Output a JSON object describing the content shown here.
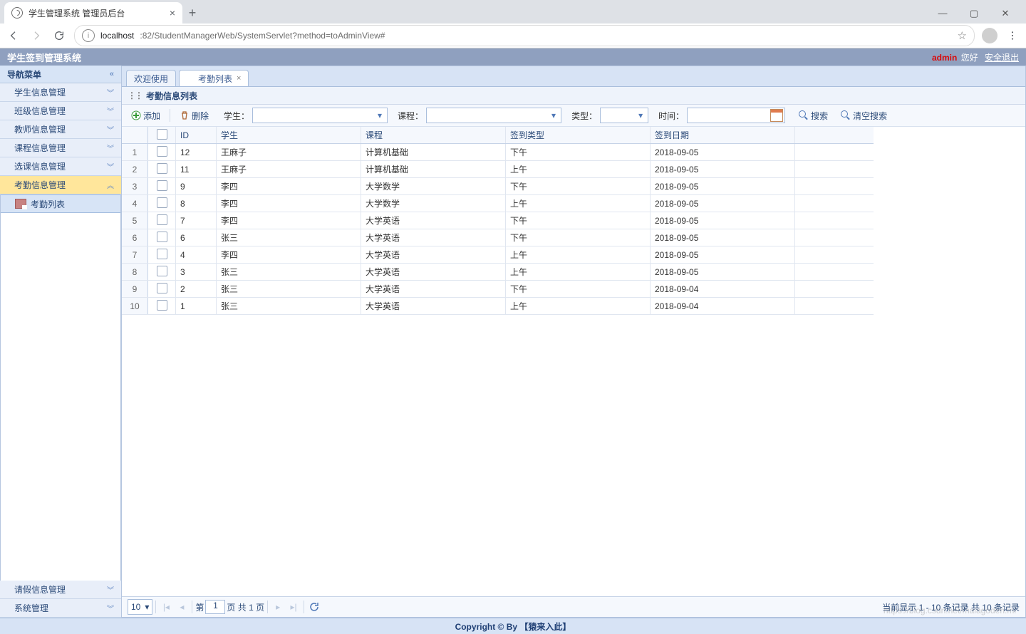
{
  "browser": {
    "tab_title": "学生管理系统 管理员后台",
    "url_host": "localhost",
    "url_path": ":82/StudentManagerWeb/SystemServlet?method=toAdminView#"
  },
  "appbar": {
    "title": "学生签到管理系统",
    "user": "admin",
    "hello": "您好",
    "logout": "安全退出"
  },
  "nav": {
    "header": "导航菜单",
    "items": [
      {
        "label": "学生信息管理",
        "selected": false
      },
      {
        "label": "班级信息管理",
        "selected": false
      },
      {
        "label": "教师信息管理",
        "selected": false
      },
      {
        "label": "课程信息管理",
        "selected": false
      },
      {
        "label": "选课信息管理",
        "selected": false
      },
      {
        "label": "考勤信息管理",
        "selected": true
      }
    ],
    "sub_item": "考勤列表",
    "bottom": [
      {
        "label": "请假信息管理"
      },
      {
        "label": "系统管理"
      }
    ]
  },
  "tabs": {
    "welcome": "欢迎使用",
    "attendance": "考勤列表"
  },
  "panel": {
    "title": "考勤信息列表"
  },
  "toolbar": {
    "add": "添加",
    "delete": "删除",
    "student_label": "学生：",
    "course_label": "课程：",
    "type_label": "类型：",
    "time_label": "时间：",
    "search": "搜索",
    "clear": "清空搜索"
  },
  "table": {
    "headers": {
      "id": "ID",
      "student": "学生",
      "course": "课程",
      "type": "签到类型",
      "date": "签到日期"
    },
    "rows": [
      {
        "n": "1",
        "id": "12",
        "student": "王麻子",
        "course": "计算机基础",
        "type": "下午",
        "date": "2018-09-05"
      },
      {
        "n": "2",
        "id": "11",
        "student": "王麻子",
        "course": "计算机基础",
        "type": "上午",
        "date": "2018-09-05"
      },
      {
        "n": "3",
        "id": "9",
        "student": "李四",
        "course": "大学数学",
        "type": "下午",
        "date": "2018-09-05"
      },
      {
        "n": "4",
        "id": "8",
        "student": "李四",
        "course": "大学数学",
        "type": "上午",
        "date": "2018-09-05"
      },
      {
        "n": "5",
        "id": "7",
        "student": "李四",
        "course": "大学英语",
        "type": "下午",
        "date": "2018-09-05"
      },
      {
        "n": "6",
        "id": "6",
        "student": "张三",
        "course": "大学英语",
        "type": "下午",
        "date": "2018-09-05"
      },
      {
        "n": "7",
        "id": "4",
        "student": "李四",
        "course": "大学英语",
        "type": "上午",
        "date": "2018-09-05"
      },
      {
        "n": "8",
        "id": "3",
        "student": "张三",
        "course": "大学英语",
        "type": "上午",
        "date": "2018-09-05"
      },
      {
        "n": "9",
        "id": "2",
        "student": "张三",
        "course": "大学英语",
        "type": "下午",
        "date": "2018-09-04"
      },
      {
        "n": "10",
        "id": "1",
        "student": "张三",
        "course": "大学英语",
        "type": "上午",
        "date": "2018-09-04"
      }
    ]
  },
  "pager": {
    "pagesize": "10",
    "pre": "第",
    "page": "1",
    "mid": "页 共 1 页",
    "info": "当前显示 1 - 10 条记录 共 10 条记录"
  },
  "footer": "Copyright © By 【猿来入此】",
  "watermark": "https://blog.csdn.net/malagodeh.ml"
}
